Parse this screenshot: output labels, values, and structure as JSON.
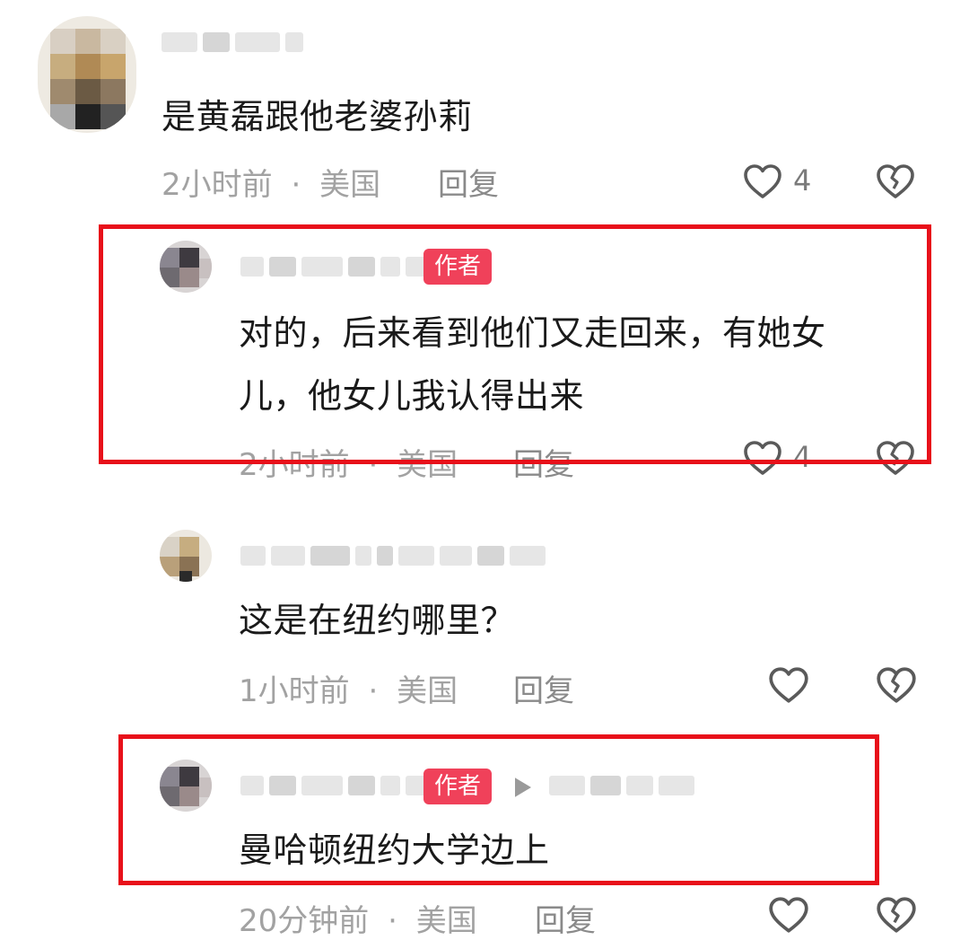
{
  "comments": [
    {
      "text": "是黄磊跟他老婆孙莉",
      "time": "2小时前",
      "location": "美国",
      "reply_label": "回复",
      "likes": "4"
    },
    {
      "author_tag": "作者",
      "text_line1": "对的，后来看到他们又走回来，有她女",
      "text_line2": "儿，他女儿我认得出来",
      "time": "2小时前",
      "location": "美国",
      "reply_label": "回复",
      "likes": "4"
    },
    {
      "text": "这是在纽约哪里？",
      "time": "1小时前",
      "location": "美国",
      "reply_label": "回复"
    },
    {
      "author_tag": "作者",
      "text": "曼哈顿纽约大学边上",
      "time": "20分钟前",
      "location": "美国",
      "reply_label": "回复"
    }
  ],
  "meta_separator": "·",
  "icons": {
    "like": "heart-outline-icon",
    "dislike": "broken-heart-icon",
    "reply_arrow": "play-arrow-icon"
  },
  "colors": {
    "author_tag": "#f0415a",
    "highlight_border": "#e8101a",
    "meta_text": "#a2a2a2"
  }
}
